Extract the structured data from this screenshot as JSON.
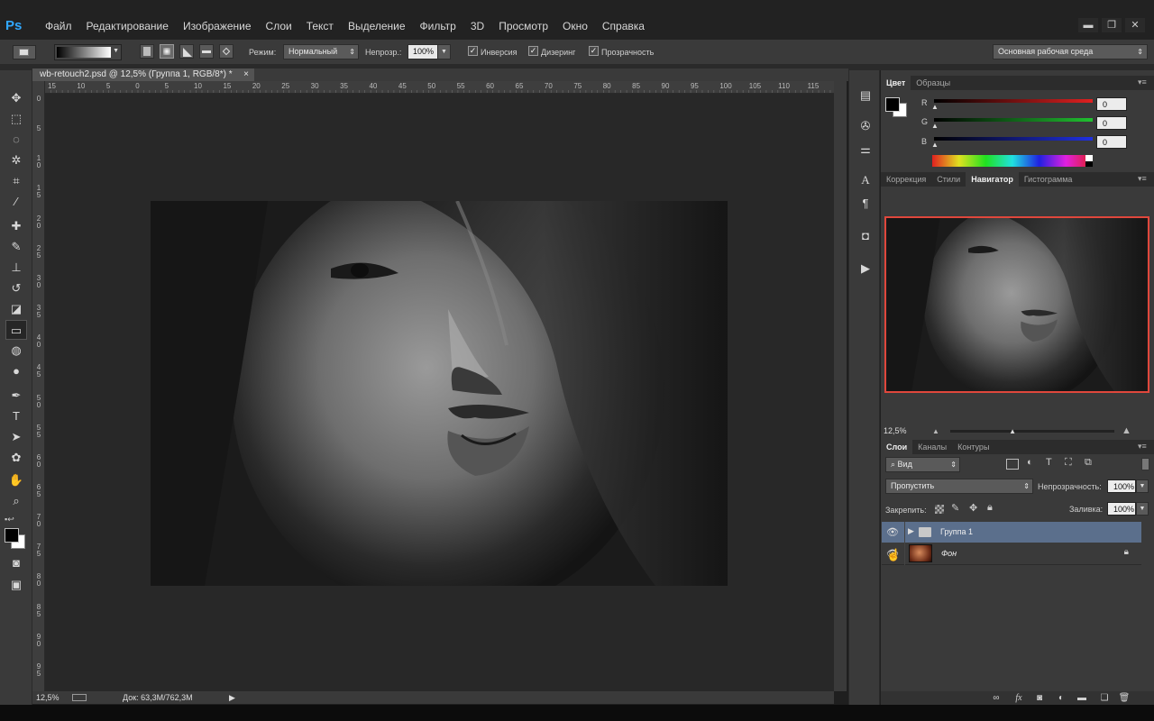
{
  "app": {
    "logo": "Ps",
    "menu": [
      "Файл",
      "Редактирование",
      "Изображение",
      "Слои",
      "Текст",
      "Выделение",
      "Фильтр",
      "3D",
      "Просмотр",
      "Окно",
      "Справка"
    ],
    "window_controls": [
      "minimize-icon",
      "restore-icon",
      "close-icon"
    ]
  },
  "options": {
    "mode_label": "Режим:",
    "mode_value": "Нормальный",
    "opacity_label": "Непрозр.:",
    "opacity_value": "100%",
    "inverse_label": "Инверсия",
    "dither_label": "Дизеринг",
    "transparency_label": "Прозрачность",
    "inverse_checked": true,
    "dither_checked": true,
    "transparency_checked": true,
    "workspace": "Основная рабочая среда"
  },
  "document": {
    "tab_title": "wb-retouch2.psd @ 12,5% (Группа 1, RGB/8*) *",
    "close_glyph": "×",
    "ruler_h": [
      "15",
      "10",
      "5",
      "0",
      "5",
      "10",
      "15",
      "20",
      "25",
      "30",
      "35",
      "40",
      "45",
      "50",
      "55",
      "60",
      "65",
      "70",
      "75",
      "80",
      "85",
      "90",
      "95",
      "100",
      "105",
      "110",
      "115"
    ],
    "ruler_v": [
      "0",
      "5",
      "1 0",
      "1 5",
      "2 0",
      "2 5",
      "3 0",
      "3 5",
      "4 0",
      "4 5",
      "5 0",
      "5 5",
      "6 0",
      "6 5",
      "7 0",
      "7 5",
      "8 0",
      "8 5",
      "9 0",
      "9 5"
    ],
    "zoom": "12,5%",
    "doc_info": "Док: 63,3M/762,3M"
  },
  "color_panel": {
    "tabs": [
      "Цвет",
      "Образцы"
    ],
    "active_tab": "Цвет",
    "channels": [
      {
        "label": "R",
        "value": "0",
        "color": "#d43a2a"
      },
      {
        "label": "G",
        "value": "0",
        "color": "#2fb43a"
      },
      {
        "label": "B",
        "value": "0",
        "color": "#3a4ad8"
      }
    ]
  },
  "navigator_panel": {
    "tabs": [
      "Коррекция",
      "Стили",
      "Навигатор",
      "Гистограмма"
    ],
    "active_tab": "Навигатор",
    "zoom": "12,5%",
    "zoom_fraction": 0.38,
    "view_box_color": "#e0473c"
  },
  "layers_panel": {
    "tabs": [
      "Слои",
      "Каналы",
      "Контуры"
    ],
    "active_tab": "Слои",
    "filter_label": "Вид",
    "blend_mode": "Пропустить",
    "opacity_label": "Непрозрачность:",
    "opacity_value": "100%",
    "lock_label": "Закрепить:",
    "fill_label": "Заливка:",
    "fill_value": "100%",
    "layers": [
      {
        "name": "Группа 1",
        "type": "group",
        "selected": true,
        "visible": true
      },
      {
        "name": "Фон",
        "type": "background",
        "selected": false,
        "visible": true,
        "locked": true
      }
    ],
    "bottom_icons": [
      "link-icon",
      "fx-icon",
      "mask-icon",
      "adjustment-icon",
      "folder-icon",
      "new-layer-icon",
      "trash-icon"
    ]
  },
  "tools": [
    "move-tool-icon",
    "marquee-tool-icon",
    "lasso-tool-icon",
    "magic-wand-icon",
    "crop-tool-icon",
    "eyedropper-icon",
    "healing-brush-icon",
    "brush-tool-icon",
    "clone-stamp-icon",
    "history-brush-icon",
    "eraser-icon",
    "gradient-tool-icon",
    "blur-tool-icon",
    "dodge-tool-icon",
    "pen-tool-icon",
    "type-tool-icon",
    "path-selection-icon",
    "shape-tool-icon",
    "hand-tool-icon",
    "zoom-tool-icon"
  ]
}
